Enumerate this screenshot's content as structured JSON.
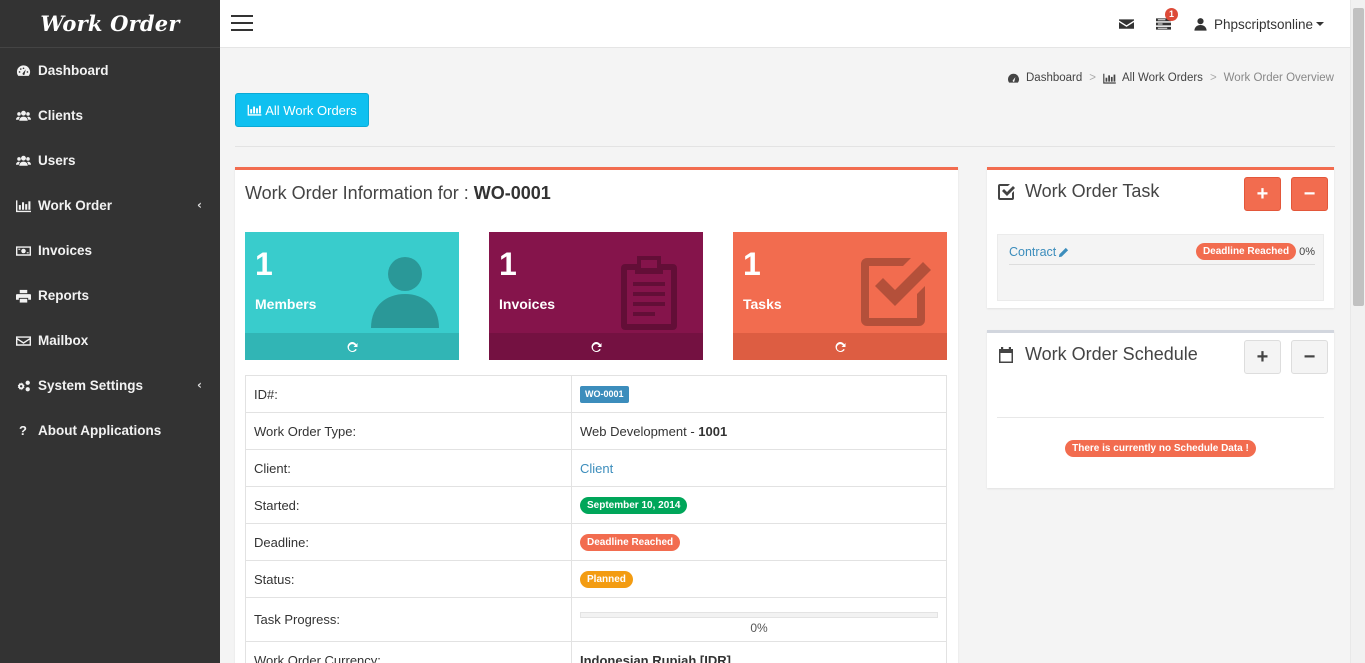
{
  "app": {
    "brand": "Work Order"
  },
  "sidebar": {
    "items": [
      {
        "label": "Dashboard",
        "icon": "dashboard-icon"
      },
      {
        "label": "Clients",
        "icon": "users-icon"
      },
      {
        "label": "Users",
        "icon": "users-icon"
      },
      {
        "label": "Work Order",
        "icon": "bar-chart-icon",
        "has_submenu": true
      },
      {
        "label": "Invoices",
        "icon": "money-icon"
      },
      {
        "label": "Reports",
        "icon": "print-icon"
      },
      {
        "label": "Mailbox",
        "icon": "envelope-icon"
      },
      {
        "label": "System Settings",
        "icon": "gears-icon",
        "has_submenu": true
      },
      {
        "label": "About Applications",
        "icon": "question-icon"
      }
    ]
  },
  "topbar": {
    "notification_count": "1",
    "user_name": "Phpscriptsonline"
  },
  "breadcrumb": {
    "items": [
      "Dashboard",
      "All Work Orders"
    ],
    "active": "Work Order Overview"
  },
  "toolbar": {
    "all_work_orders_label": "All Work Orders"
  },
  "main": {
    "title_prefix": "Work Order Information for :",
    "title_id": "WO-0001",
    "tiles": [
      {
        "count": "1",
        "label": "Members",
        "color": "#39cccc",
        "foot_color": "#31b5b5"
      },
      {
        "count": "1",
        "label": "Invoices",
        "color": "#85144b",
        "foot_color": "#741141"
      },
      {
        "count": "1",
        "label": "Tasks",
        "color": "#f26c4f",
        "foot_color": "#dd5d42"
      }
    ],
    "info": {
      "id_label": "ID#:",
      "id_value": "WO-0001",
      "type_label": "Work Order Type:",
      "type_value": "Web Development - ",
      "type_code": "1001",
      "client_label": "Client:",
      "client_value": "Client",
      "started_label": "Started:",
      "started_value": "September 10, 2014",
      "deadline_label": "Deadline:",
      "deadline_value": "Deadline Reached",
      "status_label": "Status:",
      "status_value": "Planned",
      "progress_label": "Task Progress:",
      "progress_value": "0%",
      "currency_label": "Work Order Currency:",
      "currency_value": "Indonesian Rupiah [IDR]"
    }
  },
  "task_panel": {
    "title": "Work Order Task",
    "add_label": "+",
    "remove_label": "−",
    "task": {
      "name": "Contract",
      "status": "Deadline Reached",
      "progress": "0%"
    }
  },
  "schedule_panel": {
    "title": "Work Order Schedule",
    "add_label": "+",
    "remove_label": "−",
    "empty_message": "There is currently no Schedule Data !"
  },
  "colors": {
    "sidebar_bg": "#333333",
    "accent_blue": "#0fc0f0",
    "link": "#3c8dbc",
    "red": "#f26c4f",
    "green": "#00a65a",
    "yellow": "#f39c12",
    "label_blue": "#3c8dbc"
  }
}
